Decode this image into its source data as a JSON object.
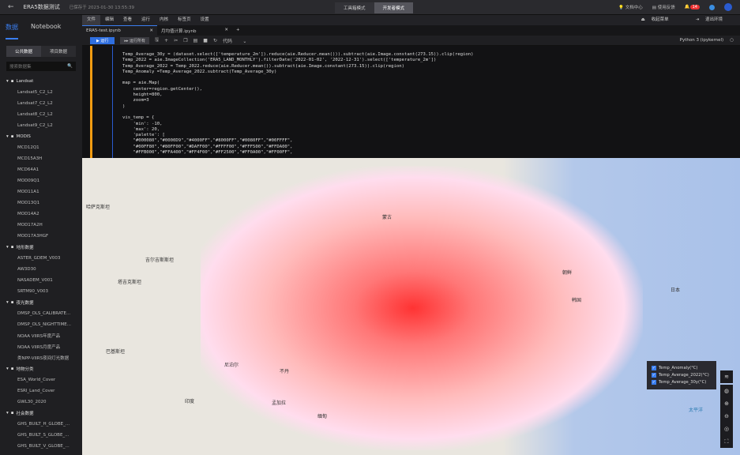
{
  "header": {
    "title": "ERA5数据测试",
    "saved": "已保存于 2023-01-30 13:55:39",
    "modes": [
      "工具箱模式",
      "开发者模式"
    ],
    "docs": "文档中心",
    "feedback": "使用反馈",
    "notifications": "14"
  },
  "sidebar": {
    "tabs": [
      "数据",
      "Notebook"
    ],
    "subtabs": [
      "公共数据",
      "项目数据"
    ],
    "search_placeholder": "搜索数据集",
    "groups": [
      {
        "name": "Landsat",
        "items": [
          "Landsat5_C2_L2",
          "Landsat7_C2_L2",
          "Landsat8_C2_L2",
          "Landsat9_C2_L2"
        ]
      },
      {
        "name": "MODIS",
        "items": [
          "MCD12Q1",
          "MCD15A3H",
          "MCD64A1",
          "MOD09Q1",
          "MOD11A1",
          "MOD13Q1",
          "MOD14A2",
          "MOD17A2H",
          "MOD17A3HGF"
        ]
      },
      {
        "name": "地形数据",
        "items": [
          "ASTER_GDEM_V003",
          "AW3D30",
          "NASADEM_V001",
          "SRTM90_V003"
        ]
      },
      {
        "name": "夜光数据",
        "items": [
          "DMSP_OLS_CALIBRATE...",
          "DMSP_OLS_NIGHTTIME...",
          "NOAA VIIRS年度产品",
          "NOAA VIIRS月度产品",
          "类NPP-VIIRS夜间灯光数据"
        ]
      },
      {
        "name": "地物分类",
        "items": [
          "ESA_World_Cover",
          "ESRI_Land_Cover",
          "GWL30_2020"
        ]
      },
      {
        "name": "社会数据",
        "items": [
          "GHS_BUILT_H_GLOBE_...",
          "GHS_BUILT_S_GLOBE_...",
          "GHS_BUILT_V_GLOBE_..."
        ]
      }
    ]
  },
  "menu": {
    "items": [
      "文件",
      "编辑",
      "查看",
      "运行",
      "内核",
      "标签页",
      "设置"
    ],
    "collapse": "收起菜单",
    "exit": "退出环境"
  },
  "tabs": [
    {
      "label": "ERA5-test.ipynb"
    },
    {
      "label": "月均值计算.ipynb"
    }
  ],
  "toolbar": {
    "run": "▶ 运行",
    "run_all": "▸▸ 运行所有",
    "cell_type": "代码",
    "kernel": "Python 3 (ipykernel)"
  },
  "code": "Temp_Average_30y = (dataset.select(['temperature_2m']).reduce(aie.Reducer.mean())).subtract(aie.Image.constant(273.15)).clip(region)\nTemp_2022 = aie.ImageCollection('ERA5_LAND_MONTHLY').filterDate('2022-01-02', '2022-12-31').select(['temperature_2m'])\nTemp_Average_2022 = Temp_2022.reduce(aie.Reducer.mean()).subtract(aie.Image.constant(273.15)).clip(region)\nTemp_Anomaly =Temp_Average_2022.subtract(Temp_Average_30y)\n\nmap = aie.Map(\n    center=region.getCenter(),\n    height=800,\n    zoom=3\n)\n\nvis_temp = {\n    'min': -10,\n    'max': 20,\n    'palette': [\n    \"#000080\",\"#0000D9\",\"#4000FF\",\"#8000FF\",\"#0080FF\",\"#00FFFF\",\n    \"#00FF80\",\"#80FF00\",\"#DAFF00\",\"#FFFF00\",\"#FFF500\",\"#FFDA00\",\n    \"#FFB000\",\"#FFA400\",\"#FF4F00\",\"#FF2500\",\"#FF0A00\",\"#FF00FF\",",
  "map": {
    "labels": [
      "哈萨克斯坦",
      "蒙古",
      "吉尔吉斯斯坦",
      "塔吉克斯坦",
      "巴基斯坦",
      "尼泊尔",
      "不丹",
      "印度",
      "孟加拉",
      "缅甸",
      "朝鲜",
      "韩国",
      "日本",
      "太平洋"
    ],
    "layers": [
      "Temp_Anomaly(°C)",
      "Temp_Average_2022(°C)",
      "Temp_Average_30y(°C)"
    ]
  }
}
